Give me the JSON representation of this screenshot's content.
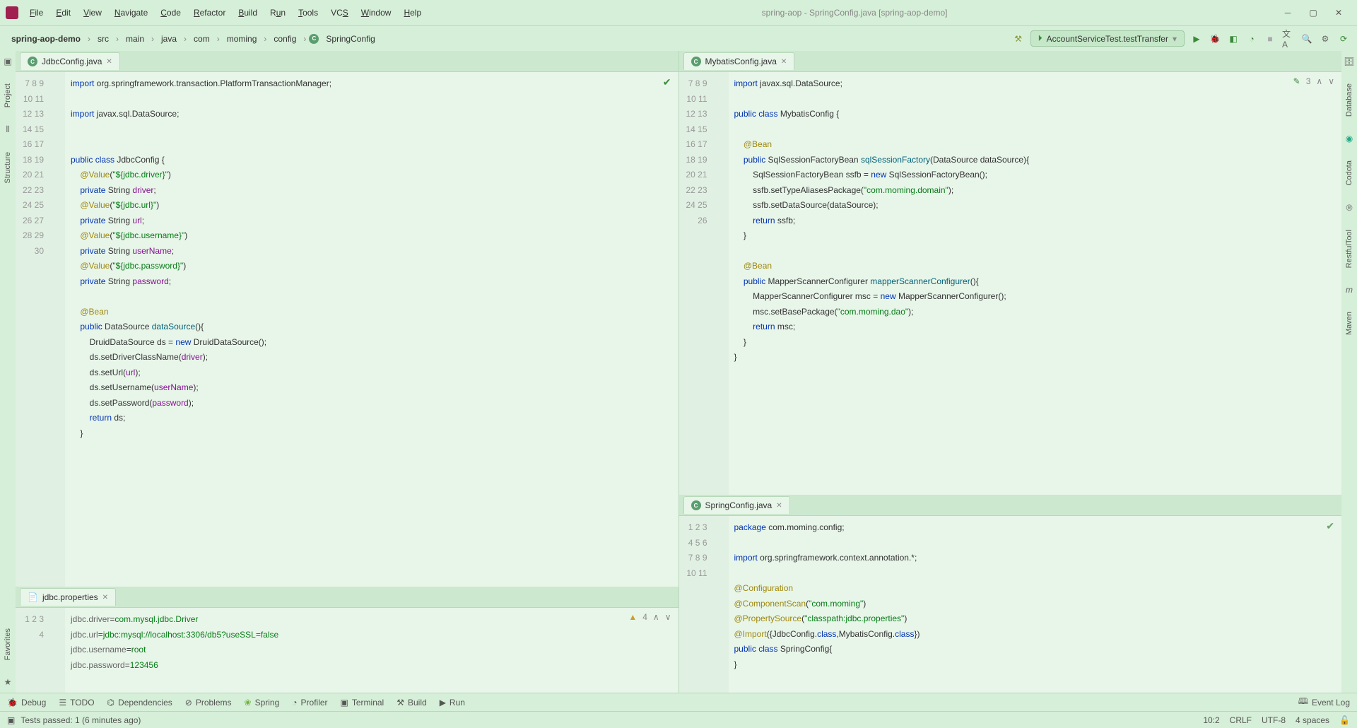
{
  "menubar": {
    "file": "File",
    "edit": "Edit",
    "view": "View",
    "navigate": "Navigate",
    "code": "Code",
    "refactor": "Refactor",
    "build": "Build",
    "run": "Run",
    "tools": "Tools",
    "vcs": "VCS",
    "window": "Window",
    "help": "Help"
  },
  "window_title": "spring-aop - SpringConfig.java [spring-aop-demo]",
  "breadcrumb": [
    "spring-aop-demo",
    "src",
    "main",
    "java",
    "com",
    "moming",
    "config",
    "SpringConfig"
  ],
  "run_config": "AccountServiceTest.testTransfer",
  "left_gutter": [
    "Project",
    "Structure"
  ],
  "right_gutter": [
    "Database",
    "Codota",
    "RestfulTool",
    "Maven"
  ],
  "tabs": {
    "left_top": "JdbcConfig.java",
    "left_bottom": "jdbc.properties",
    "right_top": "MybatisConfig.java",
    "right_bottom": "SpringConfig.java"
  },
  "editors": {
    "jdbc": {
      "start": 7,
      "lines": [
        [
          [
            "kw",
            "import"
          ],
          [
            "",
            " org.springframework.transaction.PlatformTransactionManager;"
          ]
        ],
        [
          [
            "",
            ""
          ]
        ],
        [
          [
            "kw",
            "import"
          ],
          [
            "",
            " javax.sql.DataSource;"
          ]
        ],
        [
          [
            "",
            ""
          ]
        ],
        [
          [
            "",
            ""
          ]
        ],
        [
          [
            "kw",
            "public class"
          ],
          [
            "",
            " JdbcConfig {"
          ]
        ],
        [
          [
            "",
            "    "
          ],
          [
            "ann",
            "@Value"
          ],
          [
            "",
            "("
          ],
          [
            "str",
            "\"${jdbc.driver}\""
          ],
          [
            "",
            ")"
          ]
        ],
        [
          [
            "",
            "    "
          ],
          [
            "kw",
            "private"
          ],
          [
            "",
            " String "
          ],
          [
            "id",
            "driver"
          ],
          [
            "",
            ";"
          ]
        ],
        [
          [
            "",
            "    "
          ],
          [
            "ann",
            "@Value"
          ],
          [
            "",
            "("
          ],
          [
            "str",
            "\"${jdbc.url}\""
          ],
          [
            "",
            ")"
          ]
        ],
        [
          [
            "",
            "    "
          ],
          [
            "kw",
            "private"
          ],
          [
            "",
            " String "
          ],
          [
            "id",
            "url"
          ],
          [
            "",
            ";"
          ]
        ],
        [
          [
            "",
            "    "
          ],
          [
            "ann",
            "@Value"
          ],
          [
            "",
            "("
          ],
          [
            "str",
            "\"${jdbc.username}\""
          ],
          [
            "",
            ")"
          ]
        ],
        [
          [
            "",
            "    "
          ],
          [
            "kw",
            "private"
          ],
          [
            "",
            " String "
          ],
          [
            "id",
            "userName"
          ],
          [
            "",
            ";"
          ]
        ],
        [
          [
            "",
            "    "
          ],
          [
            "ann",
            "@Value"
          ],
          [
            "",
            "("
          ],
          [
            "str",
            "\"${jdbc.password}\""
          ],
          [
            "",
            ")"
          ]
        ],
        [
          [
            "",
            "    "
          ],
          [
            "kw",
            "private"
          ],
          [
            "",
            " String "
          ],
          [
            "id",
            "password"
          ],
          [
            "",
            ";"
          ]
        ],
        [
          [
            "",
            ""
          ]
        ],
        [
          [
            "",
            "    "
          ],
          [
            "ann",
            "@Bean"
          ]
        ],
        [
          [
            "",
            "    "
          ],
          [
            "kw",
            "public"
          ],
          [
            "",
            " DataSource "
          ],
          [
            "fn",
            "dataSource"
          ],
          [
            "",
            "(){"
          ]
        ],
        [
          [
            "",
            "        DruidDataSource ds = "
          ],
          [
            "kw",
            "new"
          ],
          [
            "",
            " DruidDataSource();"
          ]
        ],
        [
          [
            "",
            "        ds.setDriverClassName("
          ],
          [
            "id",
            "driver"
          ],
          [
            "",
            ");"
          ]
        ],
        [
          [
            "",
            "        ds.setUrl("
          ],
          [
            "id",
            "url"
          ],
          [
            "",
            ");"
          ]
        ],
        [
          [
            "",
            "        ds.setUsername("
          ],
          [
            "id",
            "userName"
          ],
          [
            "",
            ");"
          ]
        ],
        [
          [
            "",
            "        ds.setPassword("
          ],
          [
            "id",
            "password"
          ],
          [
            "",
            ");"
          ]
        ],
        [
          [
            "",
            "        "
          ],
          [
            "kw",
            "return"
          ],
          [
            "",
            " ds;"
          ]
        ],
        [
          [
            "",
            "    }"
          ]
        ]
      ]
    },
    "mybatis": {
      "start": 7,
      "status": "3",
      "lines": [
        [
          [
            "kw",
            "import"
          ],
          [
            "",
            " javax.sql.DataSource;"
          ]
        ],
        [
          [
            "",
            ""
          ]
        ],
        [
          [
            "kw",
            "public class"
          ],
          [
            "",
            " MybatisConfig {"
          ]
        ],
        [
          [
            "",
            ""
          ]
        ],
        [
          [
            "",
            "    "
          ],
          [
            "ann",
            "@Bean"
          ]
        ],
        [
          [
            "",
            "    "
          ],
          [
            "kw",
            "public"
          ],
          [
            "",
            " SqlSessionFactoryBean "
          ],
          [
            "fn",
            "sqlSessionFactory"
          ],
          [
            "",
            "(DataSource dataSource){"
          ]
        ],
        [
          [
            "",
            "        SqlSessionFactoryBean ssfb = "
          ],
          [
            "kw",
            "new"
          ],
          [
            "",
            " SqlSessionFactoryBean();"
          ]
        ],
        [
          [
            "",
            "        ssfb.setTypeAliasesPackage("
          ],
          [
            "str",
            "\"com.moming.domain\""
          ],
          [
            "",
            ");"
          ]
        ],
        [
          [
            "",
            "        ssfb.setDataSource(dataSource);"
          ]
        ],
        [
          [
            "",
            "        "
          ],
          [
            "kw",
            "return"
          ],
          [
            "",
            " ssfb;"
          ]
        ],
        [
          [
            "",
            "    }"
          ]
        ],
        [
          [
            "",
            ""
          ]
        ],
        [
          [
            "",
            "    "
          ],
          [
            "ann",
            "@Bean"
          ]
        ],
        [
          [
            "",
            "    "
          ],
          [
            "kw",
            "public"
          ],
          [
            "",
            " MapperScannerConfigurer "
          ],
          [
            "fn",
            "mapperScannerConfigurer"
          ],
          [
            "",
            "(){"
          ]
        ],
        [
          [
            "",
            "        MapperScannerConfigurer msc = "
          ],
          [
            "kw",
            "new"
          ],
          [
            "",
            " MapperScannerConfigurer();"
          ]
        ],
        [
          [
            "",
            "        msc.setBasePackage("
          ],
          [
            "str",
            "\"com.moming.dao\""
          ],
          [
            "",
            ");"
          ]
        ],
        [
          [
            "",
            "        "
          ],
          [
            "kw",
            "return"
          ],
          [
            "",
            " msc;"
          ]
        ],
        [
          [
            "",
            "    }"
          ]
        ],
        [
          [
            "",
            "}"
          ]
        ],
        [
          [
            "",
            ""
          ]
        ]
      ]
    },
    "spring": {
      "start": 1,
      "lines": [
        [
          [
            "kw",
            "package"
          ],
          [
            "",
            " com.moming.config;"
          ]
        ],
        [
          [
            "",
            ""
          ]
        ],
        [
          [
            "kw",
            "import"
          ],
          [
            "",
            " org.springframework.context.annotation.*;"
          ]
        ],
        [
          [
            "",
            ""
          ]
        ],
        [
          [
            "ann",
            "@Configuration"
          ]
        ],
        [
          [
            "ann",
            "@ComponentScan"
          ],
          [
            "",
            "("
          ],
          [
            "str",
            "\"com.moming\""
          ],
          [
            "",
            ")"
          ]
        ],
        [
          [
            "ann",
            "@PropertySource"
          ],
          [
            "",
            "("
          ],
          [
            "str",
            "\"classpath:jdbc.properties\""
          ],
          [
            "",
            ")"
          ]
        ],
        [
          [
            "ann",
            "@Import"
          ],
          [
            "",
            "({JdbcConfig."
          ],
          [
            "kw",
            "class"
          ],
          [
            "",
            ",MybatisConfig."
          ],
          [
            "kw",
            "class"
          ],
          [
            "",
            "})"
          ]
        ],
        [
          [
            "kw",
            "public class"
          ],
          [
            "",
            " SpringConfig{"
          ]
        ],
        [
          [
            "",
            "}"
          ]
        ],
        [
          [
            "",
            ""
          ]
        ]
      ]
    },
    "props": {
      "start": 1,
      "status": "4",
      "lines": [
        [
          [
            "prop-key",
            "jdbc.driver"
          ],
          [
            "",
            "="
          ],
          [
            "prop-val",
            "com.mysql.jdbc.Driver"
          ]
        ],
        [
          [
            "prop-key",
            "jdbc.url"
          ],
          [
            "",
            "="
          ],
          [
            "prop-val",
            "jdbc:mysql://localhost:3306/db5?useSSL=false"
          ]
        ],
        [
          [
            "prop-key",
            "jdbc.username"
          ],
          [
            "",
            "="
          ],
          [
            "prop-val",
            "root"
          ]
        ],
        [
          [
            "prop-key",
            "jdbc.password"
          ],
          [
            "",
            "="
          ],
          [
            "prop-val",
            "123456"
          ]
        ]
      ]
    }
  },
  "bottom": {
    "debug": "Debug",
    "todo": "TODO",
    "deps": "Dependencies",
    "problems": "Problems",
    "spring": "Spring",
    "profiler": "Profiler",
    "terminal": "Terminal",
    "build": "Build",
    "run": "Run",
    "eventlog": "Event Log"
  },
  "status": {
    "tests": "Tests passed: 1 (6 minutes ago)",
    "pos": "10:2",
    "eol": "CRLF",
    "enc": "UTF-8",
    "indent": "4 spaces"
  },
  "favorites": "Favorites"
}
